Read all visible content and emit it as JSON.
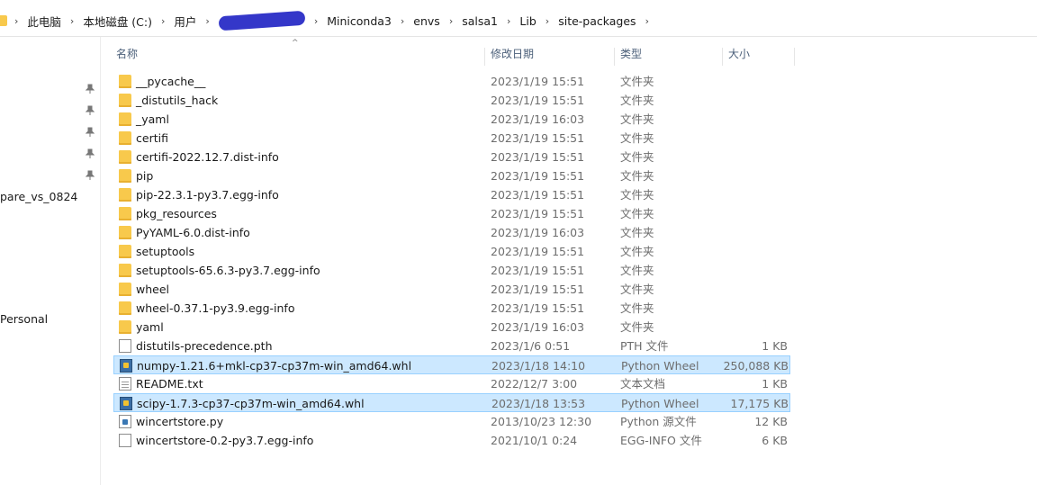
{
  "breadcrumb": {
    "items": [
      "此电脑",
      "本地磁盘 (C:)",
      "用户",
      "Miniconda3",
      "envs",
      "salsa1",
      "Lib",
      "site-packages"
    ],
    "separator": "›"
  },
  "nav": {
    "items": [
      {
        "label": "pare_vs_0824"
      },
      {
        "label": "Personal"
      }
    ],
    "pin_count": 5
  },
  "columns": {
    "name": "名称",
    "date": "修改日期",
    "type": "类型",
    "size": "大小",
    "sort_indicator": "^"
  },
  "rows": [
    {
      "name": "__pycache__",
      "date": "2023/1/19 15:51",
      "type": "文件夹",
      "size": "",
      "icon": "folder"
    },
    {
      "name": "_distutils_hack",
      "date": "2023/1/19 15:51",
      "type": "文件夹",
      "size": "",
      "icon": "folder"
    },
    {
      "name": "_yaml",
      "date": "2023/1/19 16:03",
      "type": "文件夹",
      "size": "",
      "icon": "folder"
    },
    {
      "name": "certifi",
      "date": "2023/1/19 15:51",
      "type": "文件夹",
      "size": "",
      "icon": "folder"
    },
    {
      "name": "certifi-2022.12.7.dist-info",
      "date": "2023/1/19 15:51",
      "type": "文件夹",
      "size": "",
      "icon": "folder"
    },
    {
      "name": "pip",
      "date": "2023/1/19 15:51",
      "type": "文件夹",
      "size": "",
      "icon": "folder"
    },
    {
      "name": "pip-22.3.1-py3.7.egg-info",
      "date": "2023/1/19 15:51",
      "type": "文件夹",
      "size": "",
      "icon": "folder"
    },
    {
      "name": "pkg_resources",
      "date": "2023/1/19 15:51",
      "type": "文件夹",
      "size": "",
      "icon": "folder"
    },
    {
      "name": "PyYAML-6.0.dist-info",
      "date": "2023/1/19 16:03",
      "type": "文件夹",
      "size": "",
      "icon": "folder"
    },
    {
      "name": "setuptools",
      "date": "2023/1/19 15:51",
      "type": "文件夹",
      "size": "",
      "icon": "folder"
    },
    {
      "name": "setuptools-65.6.3-py3.7.egg-info",
      "date": "2023/1/19 15:51",
      "type": "文件夹",
      "size": "",
      "icon": "folder"
    },
    {
      "name": "wheel",
      "date": "2023/1/19 15:51",
      "type": "文件夹",
      "size": "",
      "icon": "folder"
    },
    {
      "name": "wheel-0.37.1-py3.9.egg-info",
      "date": "2023/1/19 15:51",
      "type": "文件夹",
      "size": "",
      "icon": "folder"
    },
    {
      "name": "yaml",
      "date": "2023/1/19 16:03",
      "type": "文件夹",
      "size": "",
      "icon": "folder"
    },
    {
      "name": "distutils-precedence.pth",
      "date": "2023/1/6 0:51",
      "type": "PTH 文件",
      "size": "1 KB",
      "icon": "document"
    },
    {
      "name": "numpy-1.21.6+mkl-cp37-cp37m-win_amd64.whl",
      "date": "2023/1/18 14:10",
      "type": "Python Wheel",
      "size": "250,088 KB",
      "icon": "wheel",
      "selected": true
    },
    {
      "name": "README.txt",
      "date": "2022/12/7 3:00",
      "type": "文本文档",
      "size": "1 KB",
      "icon": "text"
    },
    {
      "name": "scipy-1.7.3-cp37-cp37m-win_amd64.whl",
      "date": "2023/1/18 13:53",
      "type": "Python Wheel",
      "size": "17,175 KB",
      "icon": "wheel",
      "selected": true
    },
    {
      "name": "wincertstore.py",
      "date": "2013/10/23 12:30",
      "type": "Python 源文件",
      "size": "12 KB",
      "icon": "python"
    },
    {
      "name": "wincertstore-0.2-py3.7.egg-info",
      "date": "2021/10/1 0:24",
      "type": "EGG-INFO 文件",
      "size": "6 KB",
      "icon": "document"
    }
  ],
  "colors": {
    "selection_bg": "#cce8ff",
    "selection_border": "#99d1ff",
    "folder": "#f8c94c",
    "redaction": "#3437c9"
  }
}
